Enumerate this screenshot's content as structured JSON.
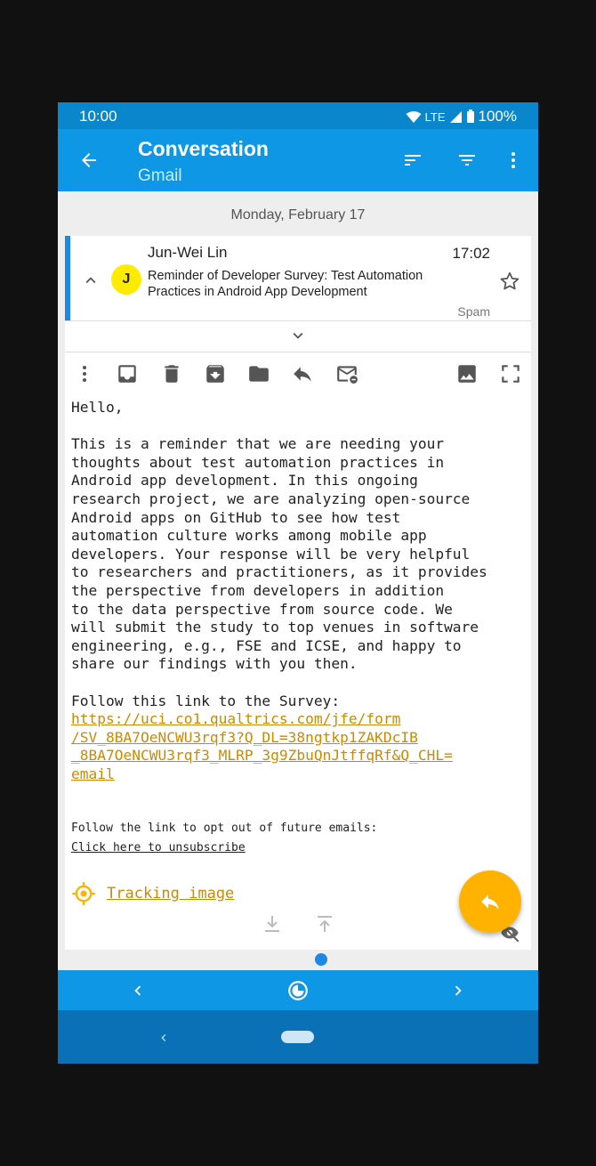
{
  "status": {
    "time": "10:00",
    "network": "LTE",
    "battery": "100%"
  },
  "appbar": {
    "title": "Conversation",
    "subtitle": "Gmail"
  },
  "date_header": "Monday, February 17",
  "message": {
    "avatar_letter": "J",
    "sender": "Jun-Wei Lin",
    "time": "17:02",
    "subject": "Reminder of Developer Survey: Test Automation Practices in Android App Development",
    "label": "Spam"
  },
  "body": {
    "greeting": "Hello,",
    "paragraph": "This is a reminder that we are needing your\nthoughts about test automation practices in\nAndroid app development. In this ongoing\nresearch project, we are analyzing open-source\nAndroid apps on GitHub to see how test\nautomation culture works among mobile app\ndevelopers. Your response will be very helpful\nto researchers and practitioners, as it provides\nthe perspective from developers in addition\nto the data perspective from source code. We\nwill submit the study to top venues in software\nengineering, e.g., FSE and ICSE, and happy to\nshare our findings with you then.",
    "survey_intro": "Follow this link to the Survey:",
    "survey_link": "https://uci.co1.qualtrics.com/jfe/form\n/SV_8BA7OeNCWU3rqf3?Q_DL=38ngtkp1ZAKDcIB\n_8BA7OeNCWU3rqf3_MLRP_3g9ZbuQnJtffqRf&Q_CHL=\nemail",
    "optout_text": "Follow the link to opt out of future emails:",
    "unsubscribe_link": "Click here to unsubscribe",
    "tracking_label": "Tracking image"
  },
  "colors": {
    "accent": "#0e97e4",
    "link": "#cc8a00",
    "fab": "#ffb300",
    "avatar": "#ffeb00"
  }
}
